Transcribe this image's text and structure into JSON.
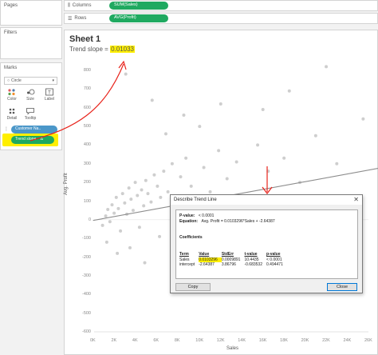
{
  "shelves": {
    "pages_label": "Pages",
    "columns_label": "Columns",
    "columns_value": "SUM(Sales)",
    "rows_label": "Rows",
    "rows_value": "AVG(Profit)"
  },
  "panels": {
    "filters_label": "Filters",
    "marks_label": "Marks",
    "marks_type": "Circle",
    "mark_buttons": [
      "Color",
      "Size",
      "Label",
      "Detail",
      "Tooltip"
    ],
    "pills": [
      "Customer Na..",
      "Trend slope"
    ]
  },
  "sheet": {
    "title": "Sheet 1",
    "trend_caption_prefix": "Trend slope = ",
    "trend_caption_value": "0.01033"
  },
  "colors": {
    "accent_green": "#1fa960",
    "accent_blue": "#4b97c9",
    "highlight": "#ffef00",
    "annotation_red": "#e8231b"
  },
  "chart_data": {
    "type": "scatter",
    "xlabel": "Sales",
    "ylabel": "Avg. Profit",
    "x_ticks": [
      "0K",
      "2K",
      "4K",
      "6K",
      "8K",
      "10K",
      "12K",
      "14K",
      "16K",
      "18K",
      "20K",
      "22K",
      "24K",
      "26K"
    ],
    "y_ticks": [
      "800",
      "700",
      "600",
      "500",
      "400",
      "300",
      "200",
      "100",
      "0",
      "-100",
      "-200",
      "-300",
      "-400",
      "-500",
      "-600"
    ],
    "xlim": [
      0,
      26000
    ],
    "ylim": [
      -600,
      800
    ],
    "trend_line": {
      "slope": 0.0103296,
      "intercept": -2.64387
    },
    "points": [
      {
        "x": 800,
        "y": -30
      },
      {
        "x": 1100,
        "y": 20
      },
      {
        "x": 1300,
        "y": 55
      },
      {
        "x": 1500,
        "y": -10
      },
      {
        "x": 1700,
        "y": 80
      },
      {
        "x": 1900,
        "y": 35
      },
      {
        "x": 2100,
        "y": 120
      },
      {
        "x": 2300,
        "y": 60
      },
      {
        "x": 2500,
        "y": -60
      },
      {
        "x": 2700,
        "y": 140
      },
      {
        "x": 2900,
        "y": 90
      },
      {
        "x": 3100,
        "y": 30
      },
      {
        "x": 3300,
        "y": 170
      },
      {
        "x": 3500,
        "y": 110
      },
      {
        "x": 3700,
        "y": 50
      },
      {
        "x": 3900,
        "y": 200
      },
      {
        "x": 4100,
        "y": 130
      },
      {
        "x": 4300,
        "y": -40
      },
      {
        "x": 4500,
        "y": 160
      },
      {
        "x": 4700,
        "y": 75
      },
      {
        "x": 4900,
        "y": 210
      },
      {
        "x": 5100,
        "y": 140
      },
      {
        "x": 5400,
        "y": 95
      },
      {
        "x": 5700,
        "y": 240
      },
      {
        "x": 6000,
        "y": 180
      },
      {
        "x": 6300,
        "y": 120
      },
      {
        "x": 6600,
        "y": 260
      },
      {
        "x": 7000,
        "y": 150
      },
      {
        "x": 7400,
        "y": 300
      },
      {
        "x": 7800,
        "y": 90
      },
      {
        "x": 8200,
        "y": 230
      },
      {
        "x": 8700,
        "y": 330
      },
      {
        "x": 9200,
        "y": 180
      },
      {
        "x": 9800,
        "y": 40
      },
      {
        "x": 10400,
        "y": 280
      },
      {
        "x": 11000,
        "y": 150
      },
      {
        "x": 11800,
        "y": 370
      },
      {
        "x": 12600,
        "y": 220
      },
      {
        "x": 13500,
        "y": 310
      },
      {
        "x": 14500,
        "y": 120
      },
      {
        "x": 15500,
        "y": 400
      },
      {
        "x": 16500,
        "y": 260
      },
      {
        "x": 18000,
        "y": 330
      },
      {
        "x": 19500,
        "y": 200
      },
      {
        "x": 21000,
        "y": 450
      },
      {
        "x": 23000,
        "y": 300
      },
      {
        "x": 1200,
        "y": -120
      },
      {
        "x": 2200,
        "y": -180
      },
      {
        "x": 3400,
        "y": -150
      },
      {
        "x": 4800,
        "y": -230
      },
      {
        "x": 6200,
        "y": -90
      },
      {
        "x": 7600,
        "y": -260
      },
      {
        "x": 9000,
        "y": -140
      },
      {
        "x": 11500,
        "y": -210
      },
      {
        "x": 14000,
        "y": -300
      },
      {
        "x": 17000,
        "y": -120
      },
      {
        "x": 20000,
        "y": -220
      },
      {
        "x": 24500,
        "y": -180
      },
      {
        "x": 3000,
        "y": 780
      },
      {
        "x": 5500,
        "y": 640
      },
      {
        "x": 8500,
        "y": 560
      },
      {
        "x": 12000,
        "y": 620
      },
      {
        "x": 16000,
        "y": 590
      },
      {
        "x": 22000,
        "y": 820
      },
      {
        "x": 25500,
        "y": 540
      },
      {
        "x": 6800,
        "y": 460
      },
      {
        "x": 10000,
        "y": 500
      },
      {
        "x": 18500,
        "y": 690
      }
    ]
  },
  "dialog": {
    "title": "Describe Trend Line",
    "close_glyph": "✕",
    "pvalue_label": "P-value:",
    "pvalue_value": "< 0.0001",
    "equation_label": "Equation:",
    "equation_value": "Avg. Profit = 0.0103296*Sales + -2.64387",
    "coef_title": "Coefficients",
    "coef_headers": [
      "Term",
      "Value",
      "StdErr",
      "t-value",
      "p-value"
    ],
    "coef_rows": [
      [
        "Sales",
        "0.0103296",
        "0.0009891",
        "10.4435",
        "< 0.0001"
      ],
      [
        "intercept",
        "-2.64387",
        "3.86796",
        "-0.683532",
        "0.494471"
      ]
    ],
    "copy_label": "Copy",
    "close_label": "Close"
  }
}
